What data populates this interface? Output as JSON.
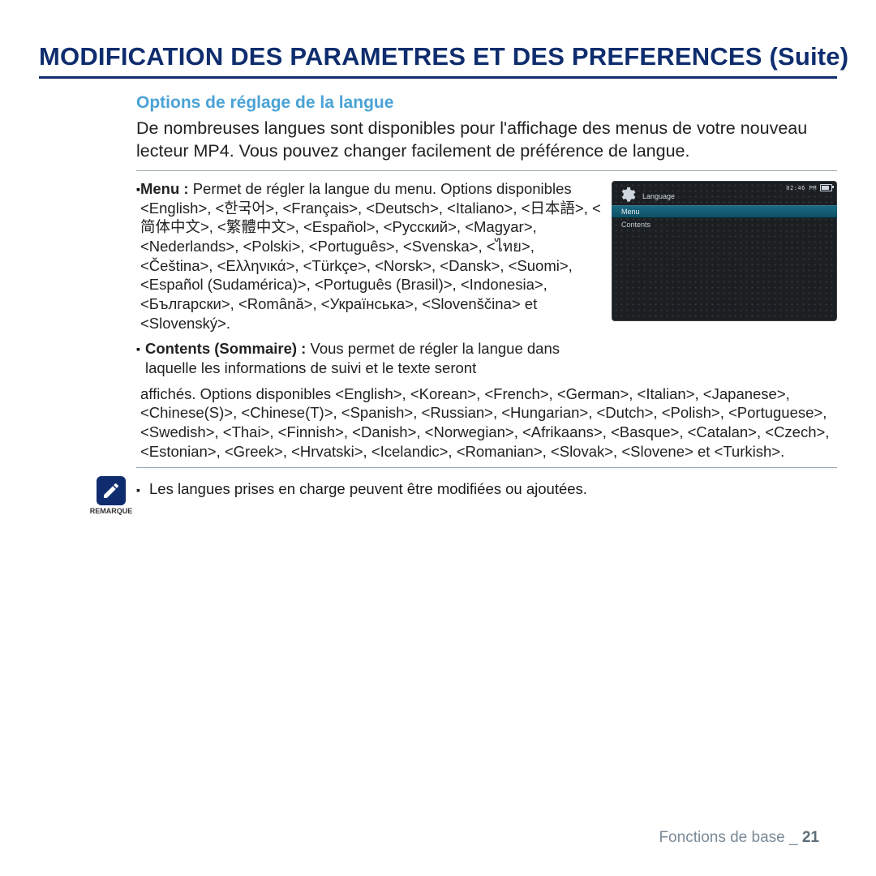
{
  "page_title": "MODIFICATION DES PARAMETRES ET DES PREFERENCES (Suite)",
  "subheading": "Options de réglage de la langue",
  "intro": "De nombreuses langues sont disponibles pour l'affichage des menus de votre nouveau lecteur MP4. Vous pouvez changer facilement de préférence de langue.",
  "bullets": {
    "menu": {
      "label": "Menu :",
      "text": " Permet de régler la langue du menu. Options disponibles <English>, <한국어>, <Français>, <Deutsch>, <Italiano>, <日本語>, <简体中文>, <繁體中文>, <Español>, <Русский>, <Magyar>, <Nederlands>, <Polski>, <Português>, <Svenska>, <ไทย>, <Čeština>, <Ελληνικά>, <Türkçe>, <Norsk>, <Dansk>, <Suomi>, <Español (Sudamérica)>, <Português (Brasil)>, <Indonesia>, <Български>, <Română>, <Українська>, <Slovenščina> et <Slovenský>."
    },
    "contents": {
      "label": "Contents (Sommaire) :",
      "text_head": " Vous permet de régler la langue dans laquelle les informations de suivi et le texte seront",
      "text_tail": "affichés. Options disponibles <English>, <Korean>, <French>, <German>, <Italian>, <Japanese>, <ChineseS(>, <ChineseT(>, <Spanish>, <Russian>, <Hungarian>, <Dutch>, <Polish>, <Portuguese>, <Swedish>, <Thai>, <Finnish>, <Danish>, <Norwegian>, <Afrikaans>, <Basque>, <Catalan>, <Czech>, <Estonian>, <Greek>, <Hrvatski>, <Icelandic>, <Romanian>, <Slovak>, <Slovene> et <Turkish>.",
      "full_sub": "affichés. Options disponibles <English>, <Korean>, <French>, <German>, <Italian>, <Japanese>, <Chinese(S)>, <Chinese(T)>, <Spanish>, <Russian>, <Hungarian>, <Dutch>, <Polish>, <Portuguese>, <Swedish>, <Thai>, <Finnish>, <Danish>, <Norwegian>, <Afrikaans>, <Basque>, <Catalan>, <Czech>, <Estonian>, <Greek>, <Hrvatski>, <Icelandic>, <Romanian>, <Slovak>, <Slovene> et <Turkish>."
    }
  },
  "device": {
    "clock": "02:46 PM",
    "crumb": "Language",
    "row_selected": "Menu",
    "row_unselected": "Contents"
  },
  "remark": {
    "label": "REMARQUE",
    "text": "Les langues prises en charge peuvent être modifiées ou ajoutées."
  },
  "footer": {
    "section": "Fonctions de base _",
    "page": "21"
  }
}
